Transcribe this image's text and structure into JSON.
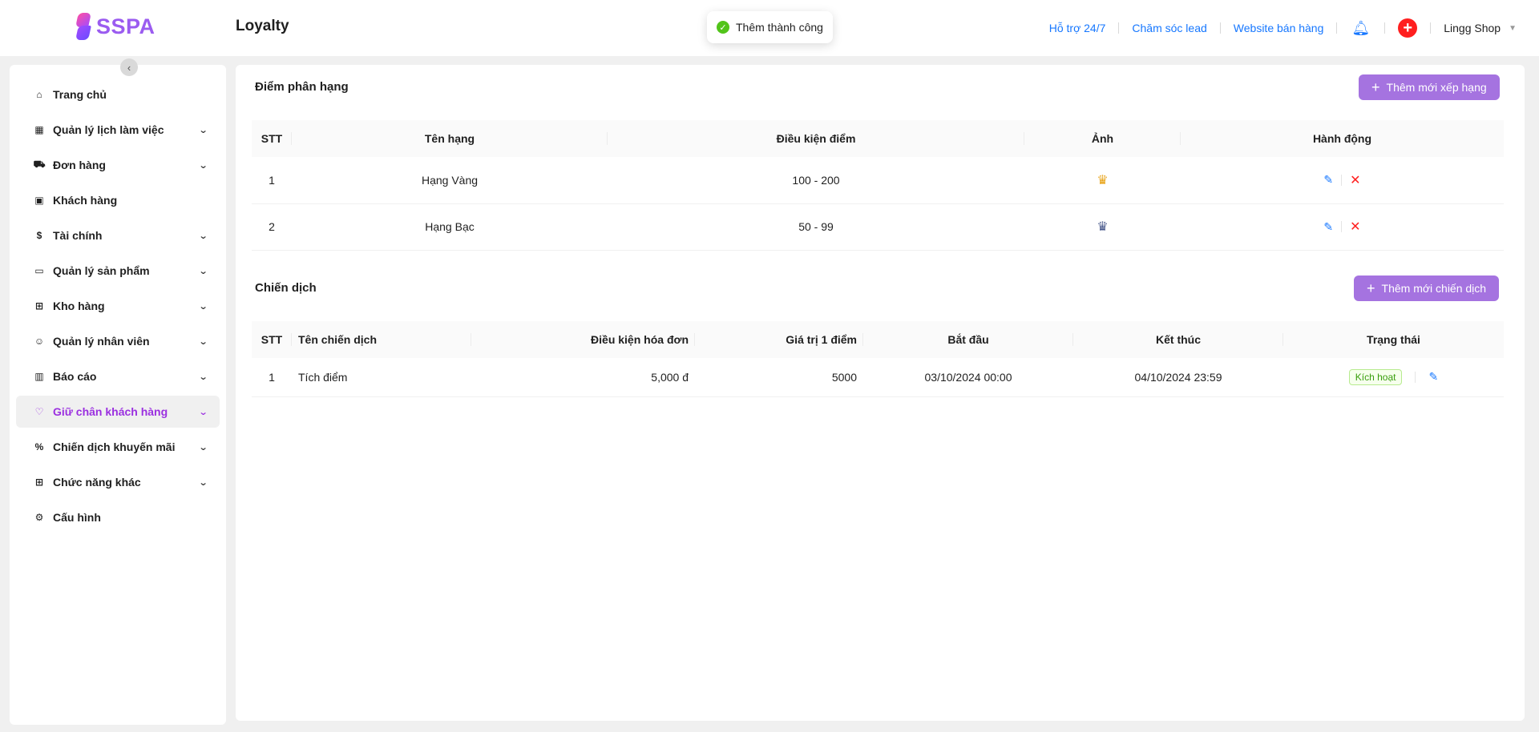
{
  "header": {
    "logo_text": "SSPA",
    "title": "Loyalty",
    "toast": "Thêm thành công",
    "links": [
      "Hỗ trợ 24/7",
      "Chăm sóc lead",
      "Website bán hàng"
    ],
    "shop_name": "Lingg Shop"
  },
  "sidebar": {
    "items": [
      {
        "label": "Trang chủ",
        "icon": "home-icon",
        "glyph": "⌂",
        "chevron": false
      },
      {
        "label": "Quản lý lịch làm việc",
        "icon": "calendar-icon",
        "glyph": "▦",
        "chevron": true
      },
      {
        "label": "Đơn hàng",
        "icon": "cart-icon",
        "glyph": "⛟",
        "chevron": true
      },
      {
        "label": "Khách hàng",
        "icon": "customer-icon",
        "glyph": "▣",
        "chevron": false
      },
      {
        "label": "Tài chính",
        "icon": "dollar-icon",
        "glyph": "$",
        "chevron": true
      },
      {
        "label": "Quản lý sản phẩm",
        "icon": "box-icon",
        "glyph": "▭",
        "chevron": true
      },
      {
        "label": "Kho hàng",
        "icon": "warehouse-icon",
        "glyph": "⊞",
        "chevron": true
      },
      {
        "label": "Quản lý nhân viên",
        "icon": "staff-icon",
        "glyph": "☺",
        "chevron": true
      },
      {
        "label": "Báo cáo",
        "icon": "chart-icon",
        "glyph": "▥",
        "chevron": true
      },
      {
        "label": "Giữ chân khách hàng",
        "icon": "heart-icon",
        "glyph": "♡",
        "chevron": true,
        "active": true
      },
      {
        "label": "Chiến dịch khuyến mãi",
        "icon": "percent-icon",
        "glyph": "%",
        "chevron": true
      },
      {
        "label": "Chức năng khác",
        "icon": "grid-icon",
        "glyph": "⊞",
        "chevron": true
      },
      {
        "label": "Cấu hình",
        "icon": "gear-icon",
        "glyph": "⚙",
        "chevron": false
      }
    ]
  },
  "rank": {
    "title": "Điểm phân hạng",
    "add_label": "Thêm mới xếp hạng",
    "columns": [
      "STT",
      "Tên hạng",
      "Điều kiện điểm",
      "Ảnh",
      "Hành động"
    ],
    "rows": [
      {
        "stt": "1",
        "name": "Hạng Vàng",
        "condition": "100 - 200",
        "crown": "gold"
      },
      {
        "stt": "2",
        "name": "Hạng Bạc",
        "condition": "50 - 99",
        "crown": "silver"
      }
    ]
  },
  "campaign": {
    "title": "Chiến dịch",
    "add_label": "Thêm mới chiến dịch",
    "columns": [
      "STT",
      "Tên chiến dịch",
      "Điều kiện hóa đơn",
      "Giá trị 1 điểm",
      "Bắt đầu",
      "Kết thúc",
      "Trạng thái"
    ],
    "rows": [
      {
        "stt": "1",
        "name": "Tích điểm",
        "invoice_condition": "5,000 đ",
        "point_value": "5000",
        "start": "03/10/2024 00:00",
        "end": "04/10/2024 23:59",
        "status": "Kích hoạt"
      }
    ]
  }
}
